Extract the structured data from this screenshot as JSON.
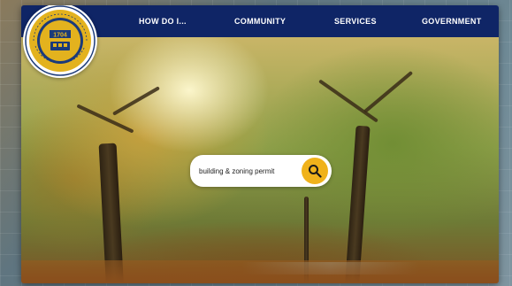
{
  "logo": {
    "name": "logo-seal",
    "year": "1704",
    "ring_text": "WHITEMARSH TOWNSHIP · PENNSYLVANIA"
  },
  "nav": {
    "items": [
      {
        "label": "HOW DO I..."
      },
      {
        "label": "COMMUNITY"
      },
      {
        "label": "SERVICES"
      },
      {
        "label": "GOVERNMENT"
      }
    ]
  },
  "search": {
    "value": "building & zoning permit",
    "icon": "search-icon"
  },
  "colors": {
    "nav_bg": "#0f2566",
    "search_button": "#f0b21b",
    "seal_gold": "#e3b21e"
  }
}
